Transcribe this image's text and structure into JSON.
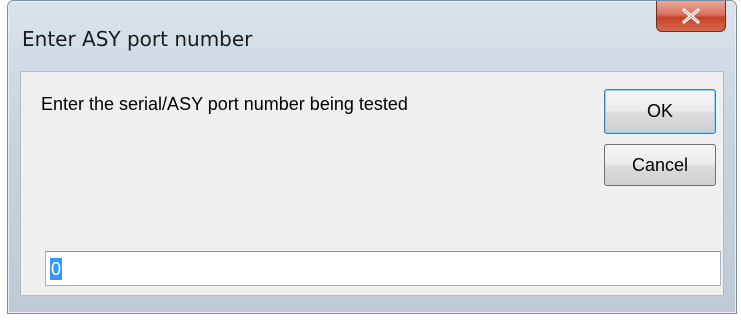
{
  "window": {
    "title": "Enter ASY port number",
    "close_symbol": "X"
  },
  "dialog": {
    "prompt": "Enter the serial/ASY port number being tested",
    "ok_label": "OK",
    "cancel_label": "Cancel",
    "input_value": "0"
  },
  "icons": {
    "close": "close-icon"
  },
  "colors": {
    "close_button": "#c4432a",
    "selection": "#3399ff",
    "default_button_border": "#3c7fb1"
  }
}
